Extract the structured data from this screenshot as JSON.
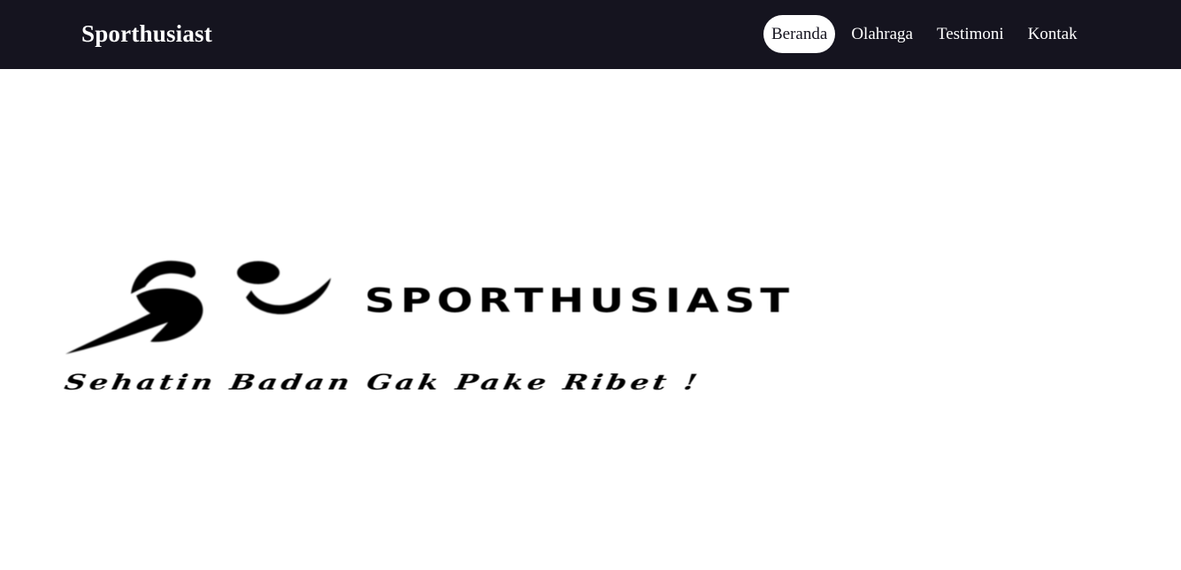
{
  "header": {
    "brand": "Sporthusiast",
    "nav": [
      {
        "label": "Beranda",
        "active": true
      },
      {
        "label": "Olahraga",
        "active": false
      },
      {
        "label": "Testimoni",
        "active": false
      },
      {
        "label": "Kontak",
        "active": false
      }
    ]
  },
  "hero": {
    "logo_text": "SPORTHUSIAST",
    "tagline": "Sehatin Badan Gak Pake Ribet !",
    "logo_icon": "runner-icon"
  },
  "colors": {
    "navbar_bg": "#15141f",
    "active_pill": "#ffffff",
    "text_light": "#ffffff",
    "text_dark": "#000000"
  }
}
